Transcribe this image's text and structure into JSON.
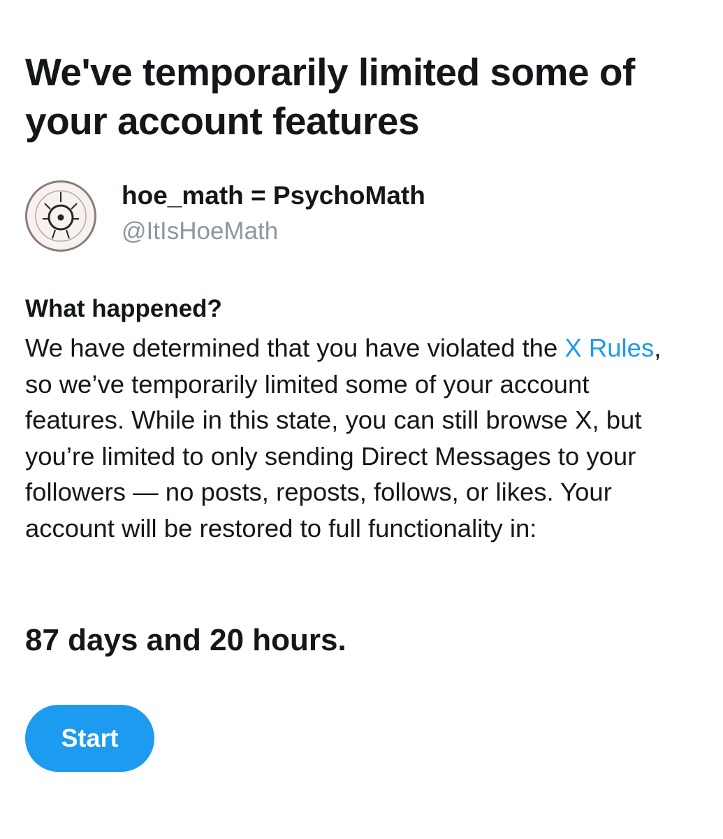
{
  "page": {
    "title": "We've temporarily limited some of your account features"
  },
  "account": {
    "display_name": "hoe_math = PsychoMath",
    "handle": "@ItIsHoeMath",
    "avatar_icon": "spiral-eye-icon"
  },
  "notice": {
    "heading": "What happened?",
    "body_before_link": "We have determined that you have violated the ",
    "link_label": "X Rules",
    "body_after_link": ", so we’ve temporarily limited some of your account features. While in this state, you can still browse X, but you’re limited to only sending Direct Messages to your followers — no posts, reposts, follows, or likes. Your account will be restored to full functionality in:",
    "countdown": "87 days and 20 hours."
  },
  "actions": {
    "start_label": "Start"
  },
  "colors": {
    "accent": "#1d9bf0",
    "text": "#14171a",
    "secondary_text": "#8c97a1",
    "background": "#ffffff"
  }
}
